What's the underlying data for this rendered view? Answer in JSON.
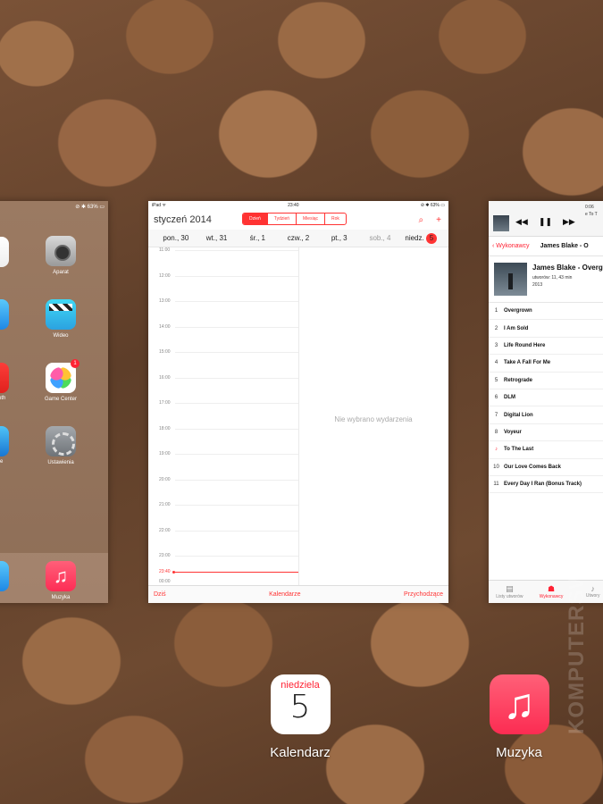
{
  "home_card": {
    "status": "⊘ ✱ 63% ▭",
    "apps": [
      {
        "label": "Aparat",
        "icon": "camera-icon"
      },
      {
        "label": "Wideo",
        "icon": "video-icon"
      },
      {
        "label": "Game Center",
        "icon": "game-center-icon",
        "badge": "1"
      },
      {
        "label": "Ustawienia",
        "icon": "settings-icon"
      }
    ],
    "partial_labels": [
      "oth",
      "e"
    ],
    "dock_app": {
      "label": "Muzyka",
      "icon": "music-icon"
    }
  },
  "calendar_card": {
    "status": {
      "left": "iPad ᯤ",
      "time": "23:40",
      "right": "⊘ ✱ 63% ▭"
    },
    "month": "styczeń 2014",
    "segments": [
      "Dzień",
      "Tydzień",
      "Miesiąc",
      "Rok"
    ],
    "days": [
      "pon., 30",
      "wt., 31",
      "śr., 1",
      "czw., 2",
      "pt., 3",
      "sob., 4",
      "niedz."
    ],
    "today_badge": "5",
    "hours": [
      "11:00",
      "12:00",
      "13:00",
      "14:00",
      "15:00",
      "16:00",
      "17:00",
      "18:00",
      "19:00",
      "20:00",
      "21:00",
      "22:00",
      "23:00",
      "23:40",
      "00:00"
    ],
    "no_event": "Nie wybrano wydarzenia",
    "bottom": {
      "today": "Dziś",
      "calendars": "Kalendarze",
      "inbox": "Przychodzące"
    }
  },
  "music_card": {
    "now_playing": "e To T",
    "time": "0:06",
    "back": "Wykonawcy",
    "nav_title": "James Blake - O",
    "album_title": "James Blake - Overgr",
    "album_meta": "utworów: 11, 43 min",
    "album_year": "2013",
    "tracks": [
      {
        "n": "1",
        "title": "Overgrown"
      },
      {
        "n": "2",
        "title": "I Am Sold"
      },
      {
        "n": "3",
        "title": "Life Round Here"
      },
      {
        "n": "4",
        "title": "Take A Fall For Me"
      },
      {
        "n": "5",
        "title": "Retrograde"
      },
      {
        "n": "6",
        "title": "DLM"
      },
      {
        "n": "7",
        "title": "Digital Lion"
      },
      {
        "n": "8",
        "title": "Voyeur"
      },
      {
        "n": "♪",
        "title": "To The Last",
        "playing": true
      },
      {
        "n": "10",
        "title": "Our Love Comes Back"
      },
      {
        "n": "11",
        "title": "Every Day I Ran (Bonus Track)"
      }
    ],
    "tabs": [
      "Listy utworów",
      "Wykonawcy",
      "Utwory"
    ]
  },
  "dock_apps": [
    {
      "label": "Kalendarz",
      "day_name": "niedziela",
      "day_number": "5"
    },
    {
      "label": "Muzyka"
    }
  ],
  "watermark": "KOMPUTERSWIAT"
}
